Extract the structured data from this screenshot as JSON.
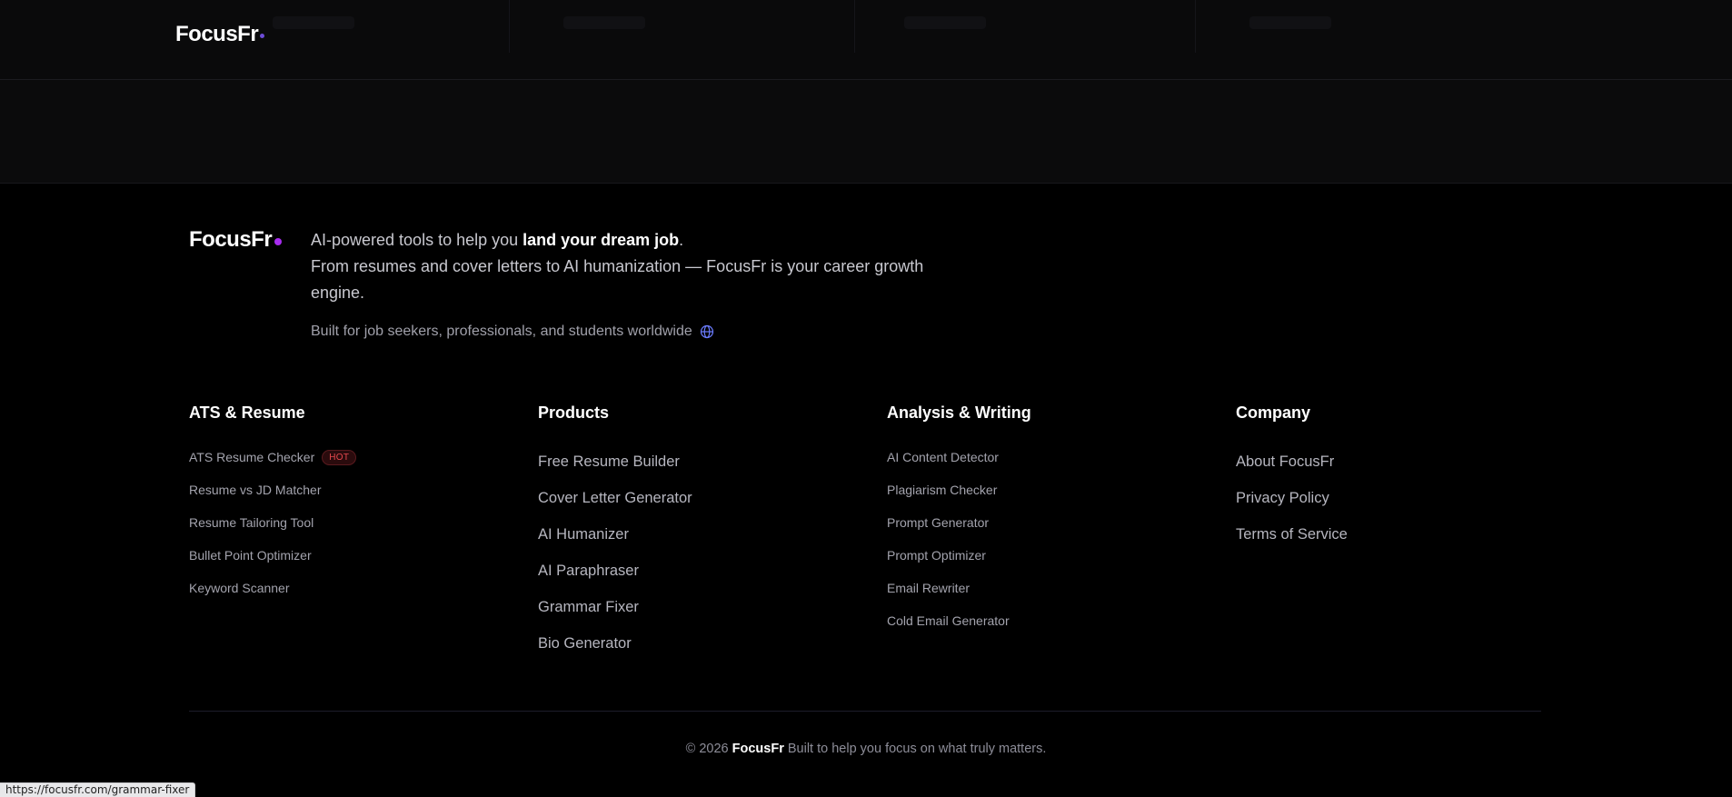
{
  "topbar": {
    "logo": "FocusFr"
  },
  "footer": {
    "brand": "FocusFr",
    "tagline": {
      "line1_pre": "AI-powered tools to help you ",
      "line1_strong": "land your dream job",
      "line1_post": ".",
      "line2": "From resumes and cover letters to AI humanization — FocusFr is your career growth engine."
    },
    "built_for": "Built for job seekers, professionals, and students worldwide",
    "columns": [
      {
        "heading": "ATS & Resume",
        "items": [
          "ATS Resume Checker",
          "Resume vs JD Matcher",
          "Resume Tailoring Tool",
          "Bullet Point Optimizer",
          "Keyword Scanner"
        ],
        "badge": "HOT"
      },
      {
        "heading": "Products",
        "items": [
          "Free Resume Builder",
          "Cover Letter Generator",
          "AI Humanizer",
          "AI Paraphraser",
          "Grammar Fixer",
          "Bio Generator"
        ]
      },
      {
        "heading": "Analysis & Writing",
        "items": [
          "AI Content Detector",
          "Plagiarism Checker",
          "Prompt Generator",
          "Prompt Optimizer",
          "Email Rewriter",
          "Cold Email Generator"
        ]
      },
      {
        "heading": "Company",
        "items": [
          "About FocusFr",
          "Privacy Policy",
          "Terms of Service"
        ]
      }
    ],
    "copyright": {
      "prefix": "© 2026",
      "brand": "FocusFr",
      "suffix": "Built to help you focus on what truly matters."
    }
  },
  "status_url": "https://focusfr.com/grammar-fixer",
  "colors": {
    "accent_dot": "#a82cf0",
    "hot_badge": "#e5484d",
    "globe": "#6b7cff"
  }
}
